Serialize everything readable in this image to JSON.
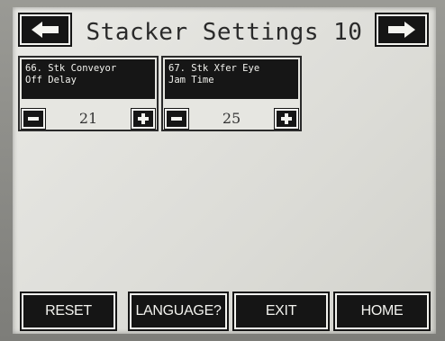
{
  "header": {
    "title": "Stacker Settings 10",
    "prev_icon": "arrow-left-icon",
    "next_icon": "arrow-right-icon"
  },
  "params": [
    {
      "label": "66. Stk Conveyor\nOff Delay",
      "value": "21"
    },
    {
      "label": "67. Stk Xfer Eye\nJam Time",
      "value": "25"
    }
  ],
  "footer": {
    "reset": "RESET",
    "language": "LANGUAGE?",
    "exit": "EXIT",
    "home": "HOME"
  },
  "colors": {
    "button_bg": "#151515",
    "button_text": "#f2f2ee",
    "screen_bg": "#e4e4df"
  }
}
